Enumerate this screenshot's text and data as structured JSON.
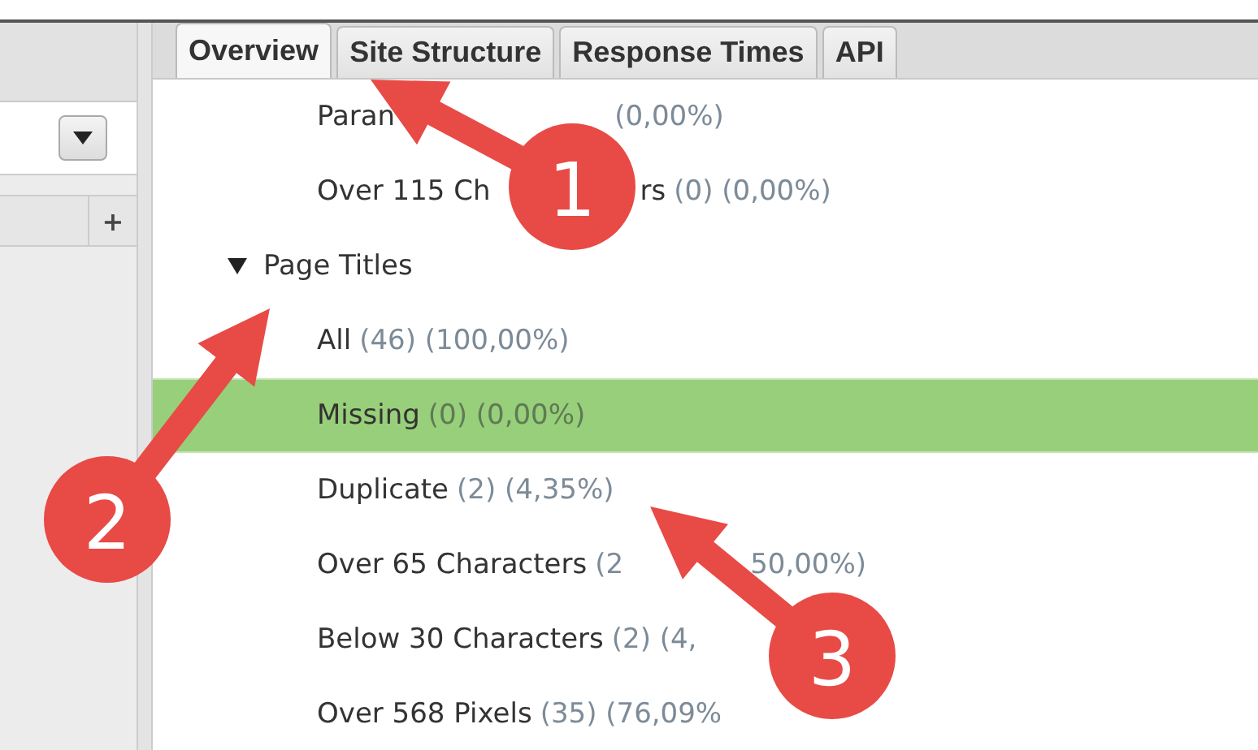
{
  "tabs": [
    {
      "label": "Overview",
      "selected": true
    },
    {
      "label": "Site Structure",
      "selected": false
    },
    {
      "label": "Response Times",
      "selected": false
    },
    {
      "label": "API",
      "selected": false
    }
  ],
  "left_panel": {
    "add_button": "+"
  },
  "tree": [
    {
      "kind": "item",
      "selected": false,
      "pieces": [
        [
          {
            "text": "Paran",
            "kind": "name"
          }
        ],
        [
          {
            "text": "(0,00%)",
            "kind": "stat"
          }
        ]
      ]
    },
    {
      "kind": "item",
      "selected": false,
      "pieces": [
        [
          {
            "text": "Over 115 Ch",
            "kind": "name"
          }
        ],
        [
          {
            "text": "rs",
            "kind": "name"
          },
          {
            "text": "(0) (0,00%)",
            "kind": "stat"
          }
        ]
      ]
    },
    {
      "kind": "group",
      "label": "Page Titles",
      "expanded": true
    },
    {
      "kind": "item",
      "selected": false,
      "pieces": [
        [
          {
            "text": "All",
            "kind": "name"
          },
          {
            "text": "(46) (100,00%)",
            "kind": "stat"
          }
        ]
      ]
    },
    {
      "kind": "item",
      "selected": true,
      "pieces": [
        [
          {
            "text": "Missing",
            "kind": "name"
          },
          {
            "text": "(0) (0,00%)",
            "kind": "stat"
          }
        ]
      ]
    },
    {
      "kind": "item",
      "selected": false,
      "pieces": [
        [
          {
            "text": "Duplicate",
            "kind": "name"
          },
          {
            "text": "(2) (4,35%)",
            "kind": "stat"
          }
        ]
      ]
    },
    {
      "kind": "item",
      "selected": false,
      "pieces": [
        [
          {
            "text": "Over 65 Characters",
            "kind": "name"
          },
          {
            "text": "(2",
            "kind": "stat"
          }
        ],
        [
          {
            "text": "50,00%)",
            "kind": "stat"
          }
        ]
      ]
    },
    {
      "kind": "item",
      "selected": false,
      "pieces": [
        [
          {
            "text": "Below 30 Characters",
            "kind": "name"
          },
          {
            "text": "(2) (4,",
            "kind": "stat"
          }
        ]
      ]
    },
    {
      "kind": "item",
      "selected": false,
      "pieces": [
        [
          {
            "text": "Over 568 Pixels",
            "kind": "name"
          },
          {
            "text": "(35) (76,09%",
            "kind": "stat"
          }
        ]
      ]
    }
  ],
  "callouts": [
    {
      "number": "1"
    },
    {
      "number": "2"
    },
    {
      "number": "3"
    }
  ]
}
